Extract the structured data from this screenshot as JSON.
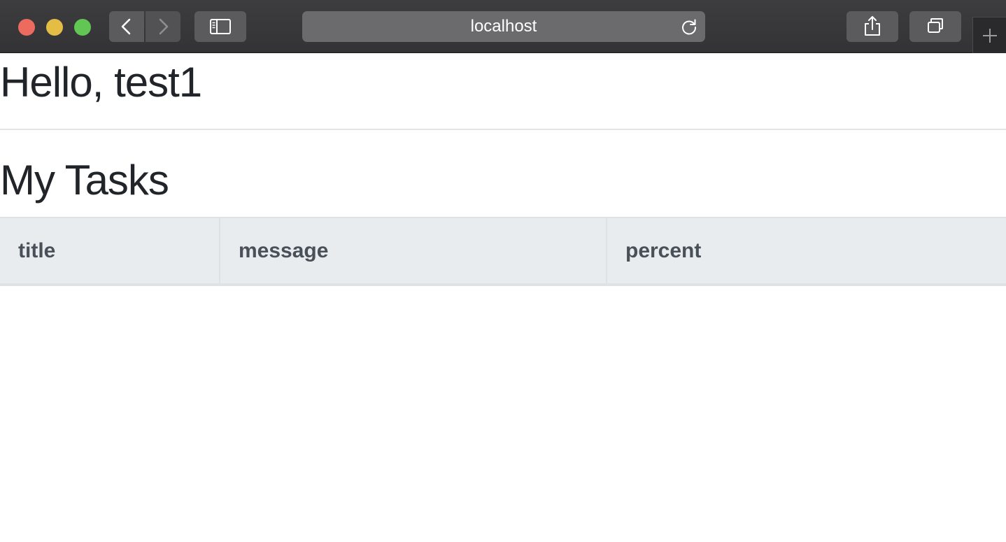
{
  "browser": {
    "address_text": "localhost"
  },
  "page": {
    "greeting": "Hello, test1",
    "section_title": "My Tasks",
    "table": {
      "columns": [
        "title",
        "message",
        "percent"
      ]
    }
  },
  "icons": {
    "back": "chevron-left-icon",
    "forward": "chevron-right-icon",
    "sidebar": "sidebar-icon",
    "reload": "reload-icon",
    "share": "share-icon",
    "tabs": "tabs-overview-icon",
    "new_tab": "plus-icon"
  },
  "colors": {
    "toolbar": "#353537",
    "window_close": "#ed6a5e",
    "window_minimize": "#e4bd45",
    "window_zoom": "#62c654",
    "heading_text": "#212529",
    "table_header_bg": "#e9ecef",
    "table_header_text": "#495057"
  }
}
